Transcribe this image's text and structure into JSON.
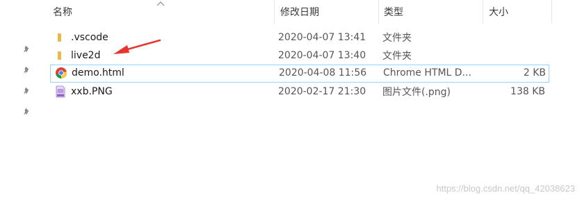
{
  "columns": {
    "name": "名称",
    "date": "修改日期",
    "type": "类型",
    "size": "大小"
  },
  "pinned_icons": [
    "pin-icon",
    "pin-icon",
    "pin-icon",
    "pin-icon"
  ],
  "files": [
    {
      "name": ".vscode",
      "date": "2020-04-07 13:41",
      "type": "文件夹",
      "size": "",
      "icon": "folder-icon"
    },
    {
      "name": "live2d",
      "date": "2020-04-07 13:40",
      "type": "文件夹",
      "size": "",
      "icon": "folder-icon"
    },
    {
      "name": "demo.html",
      "date": "2020-04-08 11:56",
      "type": "Chrome HTML D...",
      "size": "2 KB",
      "icon": "chrome-icon",
      "selected": true
    },
    {
      "name": "xxb.PNG",
      "date": "2020-02-17 21:30",
      "type": "图片文件(.png)",
      "size": "138 KB",
      "icon": "png-file-icon"
    }
  ],
  "annotation": {
    "arrow_color": "#e8362f"
  },
  "watermark": "https://blog.csdn.net/qq_42038623"
}
